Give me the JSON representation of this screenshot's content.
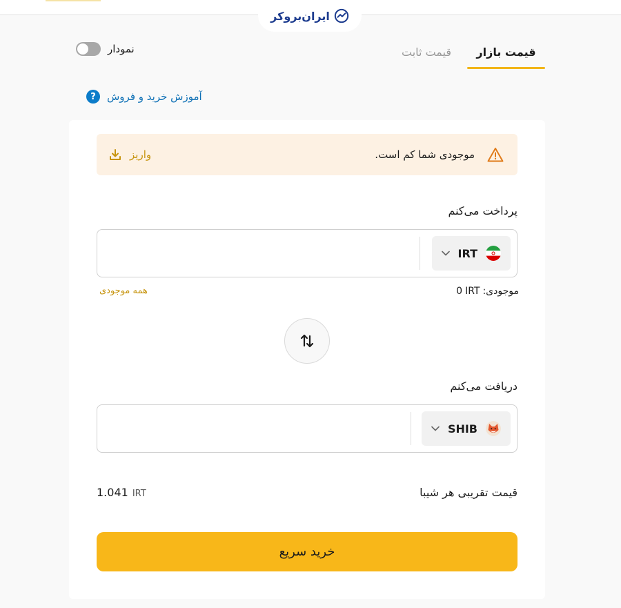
{
  "header": {
    "logo_text": "ایران‌بروکر"
  },
  "tabs": {
    "market_price": "قیمت بازار",
    "fixed_price": "قیمت ثابت"
  },
  "chart_toggle": {
    "label": "نمودار",
    "enabled": false
  },
  "tutorial": {
    "label": "آموزش خرید و فروش",
    "icon": "help-icon"
  },
  "alert": {
    "message": "موجودی شما کم است.",
    "icon": "warning-icon",
    "deposit_label": "واریز",
    "deposit_icon": "download-icon"
  },
  "pay": {
    "label": "پرداخت می‌کنم",
    "value": "",
    "currency": "IRT",
    "currency_icon": "iran-flag-icon"
  },
  "balance": {
    "label": "موجودی:",
    "unit": "IRT",
    "amount": "0",
    "all_label": "همه موجودی"
  },
  "receive": {
    "label": "دریافت می‌کنم",
    "value": "",
    "currency": "SHIB",
    "currency_icon": "shiba-inu-icon"
  },
  "price": {
    "label": "قیمت تقریبی هر شیبا",
    "unit": "IRT",
    "value": "1.041"
  },
  "buy_button": {
    "label": "خرید سریع"
  },
  "colors": {
    "accent": "#f8b719",
    "link": "#0c6fb5",
    "alert_bg": "#fdf1e3",
    "deposit": "#c7940e"
  }
}
